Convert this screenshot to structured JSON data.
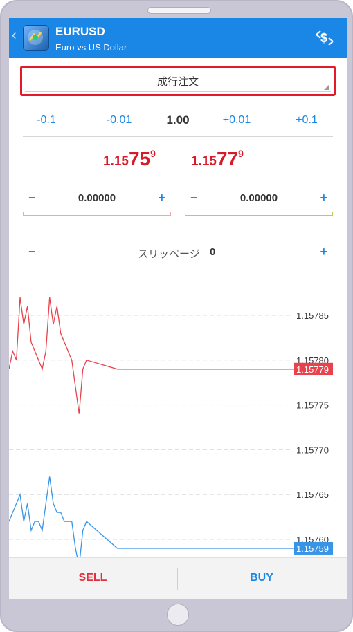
{
  "header": {
    "symbol": "EURUSD",
    "description": "Euro vs US Dollar",
    "back_icon": "chevron-left-icon",
    "trade_icon": "trade-switch-icon",
    "color": "#1a86e6"
  },
  "order_type": {
    "label": "成行注文"
  },
  "volume": {
    "minus_large": "-0.1",
    "minus_small": "-0.01",
    "value": "1.00",
    "plus_small": "+0.01",
    "plus_large": "+0.1"
  },
  "prices": {
    "sell": {
      "prefix": "1.15",
      "big": "75",
      "sup": "9"
    },
    "buy": {
      "prefix": "1.15",
      "big": "77",
      "sup": "9"
    },
    "color": "#d81b2a"
  },
  "stop_loss": {
    "minus": "−",
    "value": "0.00000",
    "plus": "+",
    "line_color": "#f2a5aa"
  },
  "take_profit": {
    "minus": "−",
    "value": "0.00000",
    "plus": "+",
    "line_color": "#b9cc54"
  },
  "slippage": {
    "minus": "−",
    "label": "スリッページ",
    "value": "0",
    "plus": "+"
  },
  "chart_data": {
    "type": "line",
    "y_ticks": [
      "1.15785",
      "1.15780",
      "1.15775",
      "1.15770",
      "1.15765",
      "1.15760"
    ],
    "ylim": [
      1.15757,
      1.15789
    ],
    "grid": true,
    "series": [
      {
        "values": [
          1.15779,
          1.15781,
          1.1578,
          1.15787,
          1.15784,
          1.15786,
          1.15782,
          1.15781,
          1.1578,
          1.15779,
          1.15781,
          1.15787,
          1.15784,
          1.15786,
          1.15783,
          1.15782,
          1.15781,
          1.1578,
          1.15777,
          1.15774,
          1.15779,
          1.1578,
          1.15779,
          1.15779,
          1.15779,
          1.15779,
          1.15779,
          1.15779,
          1.15779,
          1.15779
        ],
        "last_label": "1.15779",
        "color": "#e8424c"
      },
      {
        "values": [
          1.15762,
          1.15763,
          1.15764,
          1.15765,
          1.15762,
          1.15764,
          1.15761,
          1.15762,
          1.15762,
          1.15761,
          1.15764,
          1.15767,
          1.15764,
          1.15763,
          1.15763,
          1.15762,
          1.15762,
          1.15762,
          1.15759,
          1.15757,
          1.15761,
          1.15762,
          1.15759,
          1.15759,
          1.15759,
          1.15759,
          1.15759,
          1.15759,
          1.15759,
          1.15759
        ],
        "last_label": "1.15759",
        "color": "#3a94e6"
      }
    ]
  },
  "footer": {
    "sell_label": "SELL",
    "buy_label": "BUY",
    "sell_color": "#e0303d",
    "buy_color": "#1a86e6"
  }
}
